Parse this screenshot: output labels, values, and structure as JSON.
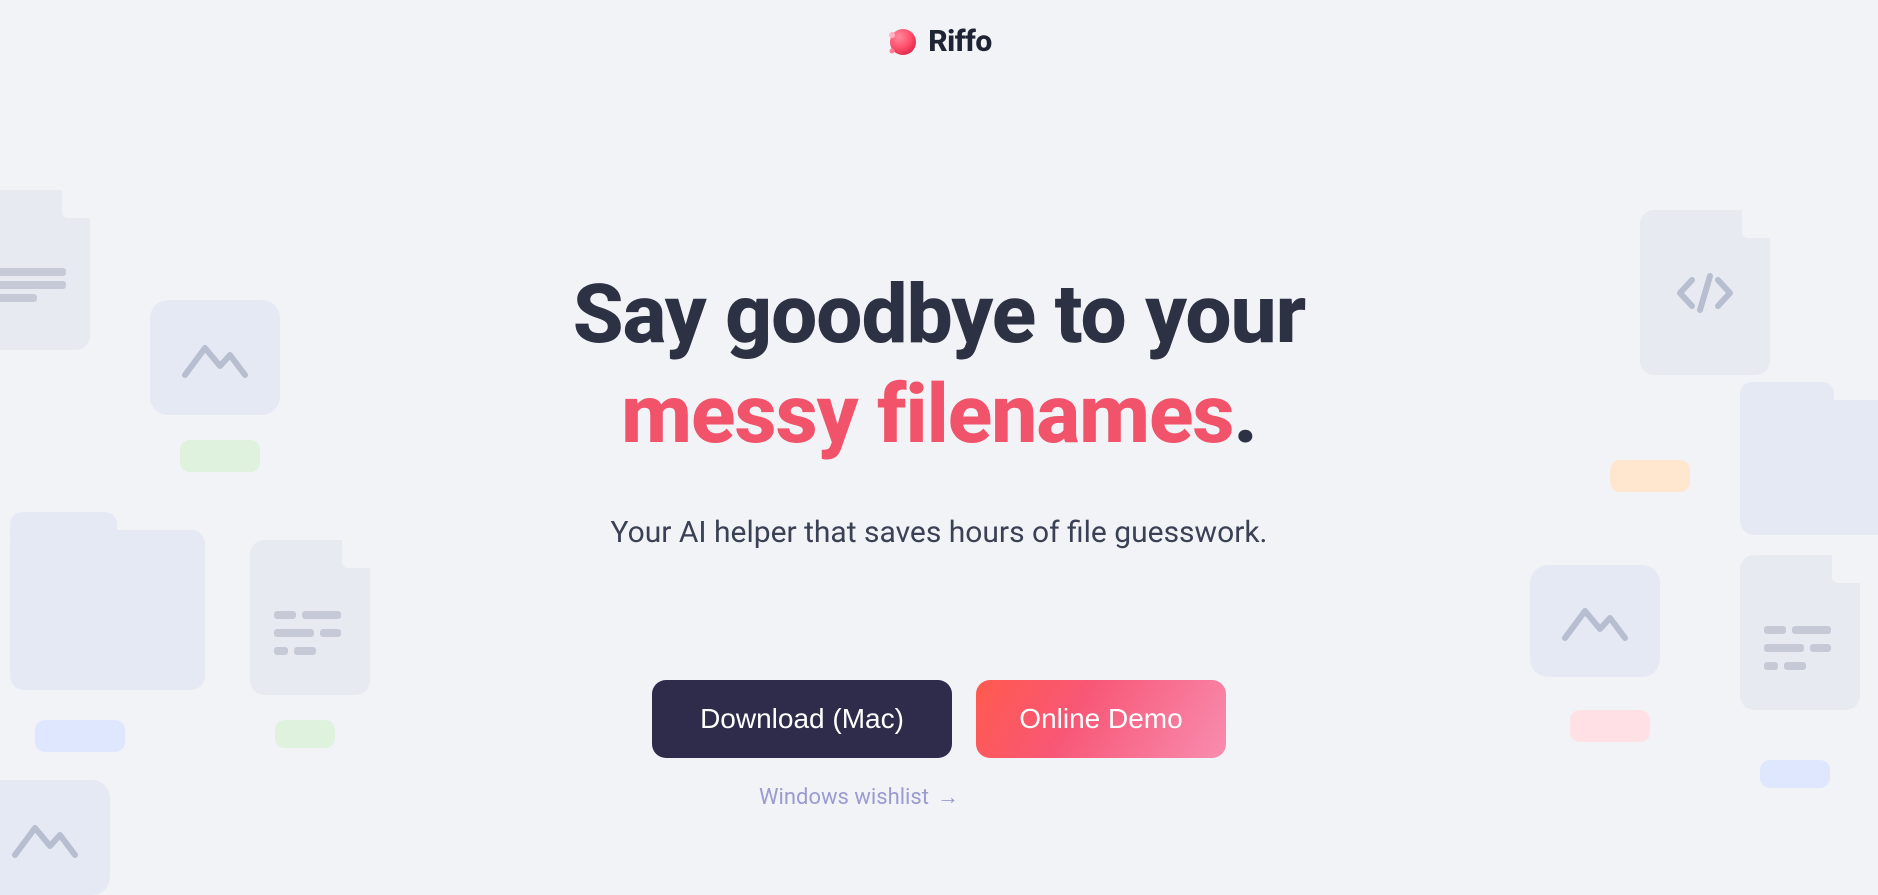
{
  "brand": {
    "name": "Riffo"
  },
  "hero": {
    "headline_pre": "Say goodbye to your",
    "headline_accent": "messy filenames",
    "headline_post": ".",
    "subtitle": "Your AI helper that saves hours of file guesswork."
  },
  "cta": {
    "primary_label": "Download (Mac)",
    "secondary_label": "Online Demo",
    "wishlist_label": "Windows wishlist"
  }
}
